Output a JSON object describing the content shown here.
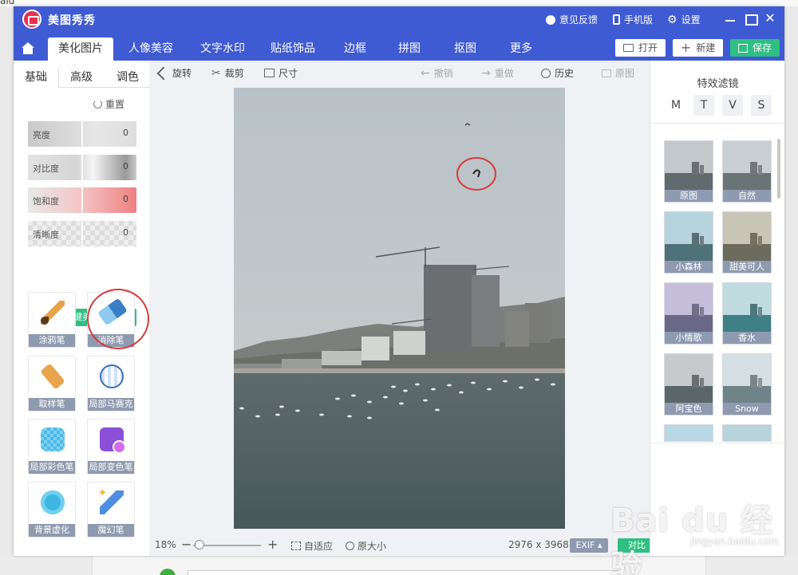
{
  "background": {
    "top_text": "aid",
    "bottom_strip": ""
  },
  "titlebar": {
    "app_name": "美图秀秀",
    "feedback": "意见反馈",
    "mobile": "手机版",
    "settings": "设置"
  },
  "tabs": [
    "美化图片",
    "人像美容",
    "文字水印",
    "贴纸饰品",
    "边框",
    "拼图",
    "抠图",
    "更多"
  ],
  "actions": {
    "open": "打开",
    "new": "新建",
    "save": "保存"
  },
  "left_panel": {
    "tabs": [
      "基础",
      "高级",
      "调色"
    ],
    "reset": "重置",
    "sliders": [
      {
        "label": "亮度",
        "value": "0"
      },
      {
        "label": "对比度",
        "value": "0"
      },
      {
        "label": "饱和度",
        "value": "0"
      },
      {
        "label": "清晰度",
        "value": "0"
      }
    ],
    "one_key": "一键美化",
    "tools": [
      "涂鸦笔",
      "消除笔",
      "取样笔",
      "局部马赛克",
      "局部彩色笔",
      "局部变色笔",
      "背景虚化",
      "魔幻笔"
    ]
  },
  "editor_toolbar": {
    "rotate": "旋转",
    "crop": "裁剪",
    "size": "尺寸",
    "undo": "撤销",
    "redo": "重做",
    "history": "历史",
    "original": "原图"
  },
  "status": {
    "zoom": "18%",
    "fit": "自适应",
    "actual": "原大小",
    "dimensions": "2976 x 3968",
    "exif": "EXIF",
    "compare": "对比"
  },
  "right_panel": {
    "title": "特效滤镜",
    "categories": [
      "M",
      "T",
      "V",
      "S"
    ],
    "filters": [
      "原图",
      "自然",
      "小森林",
      "甜美可人",
      "小情歌",
      "香水",
      "阿宝色",
      "Snow"
    ]
  },
  "watermark": {
    "main": "Bai du 经验",
    "sub": "jingyan.baidu.com"
  },
  "colors": {
    "brand_blue": "#3f5bd3",
    "accent_green": "#2fbf82",
    "label_gray": "#8e9ab0",
    "highlight_red": "#d83a3a"
  }
}
